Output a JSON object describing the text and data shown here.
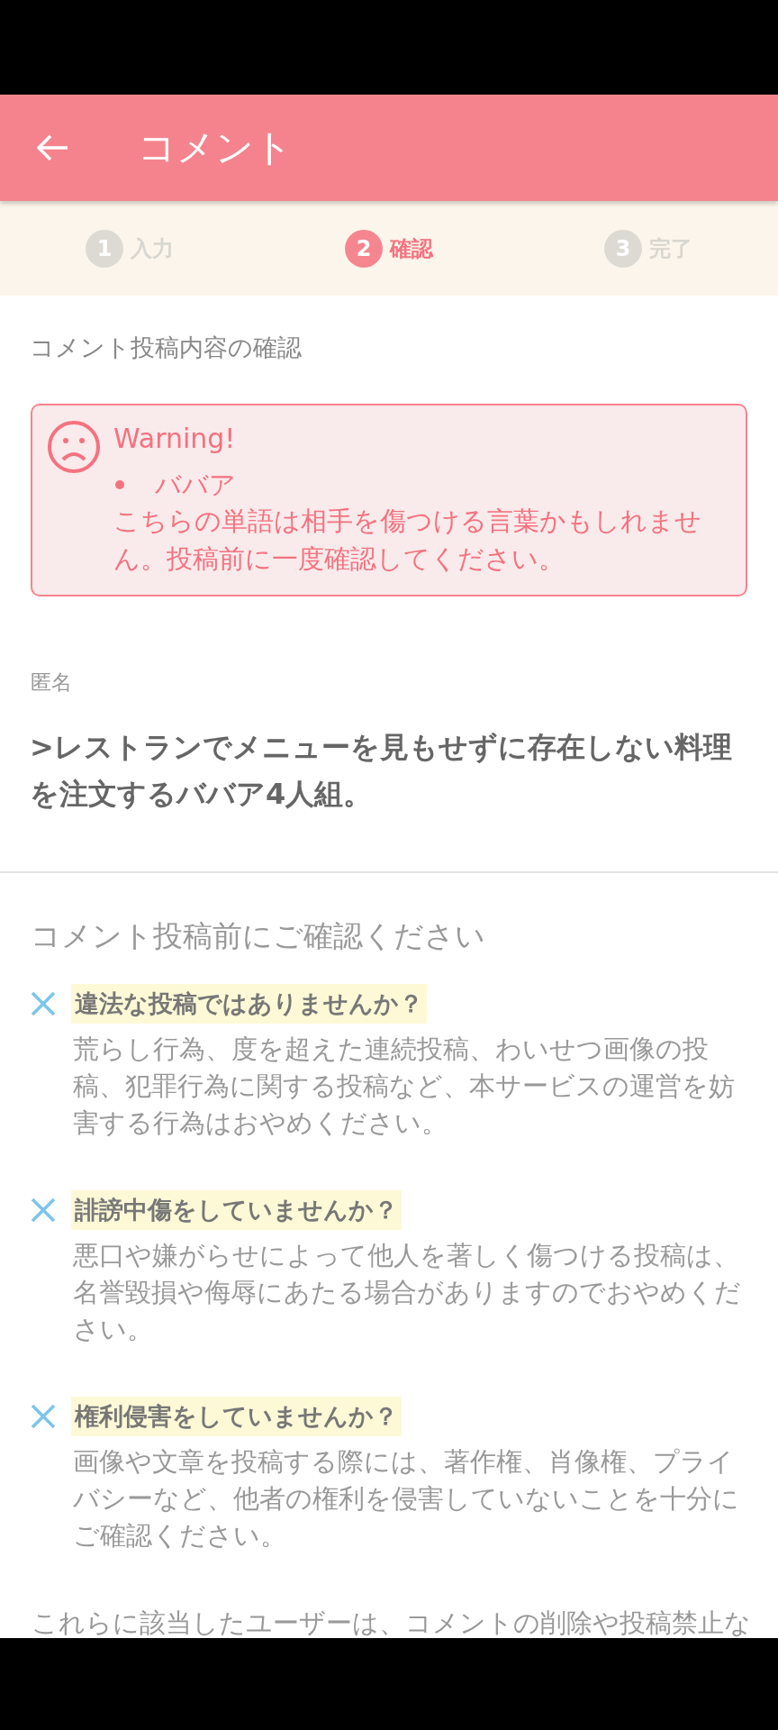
{
  "header": {
    "title": "コメント"
  },
  "steps": [
    {
      "number": "1",
      "label": "入力",
      "selected": false
    },
    {
      "number": "2",
      "label": "確認",
      "selected": true
    },
    {
      "number": "3",
      "label": "完了",
      "selected": false
    }
  ],
  "section_title": "コメント投稿内容の確認",
  "warning": {
    "title": "Warning!",
    "words": [
      "ババア"
    ],
    "message": "こちらの単語は相手を傷つける言葉かもしれません。投稿前に一度確認してください。"
  },
  "comment": {
    "author": "匿名",
    "text": ">レストランでメニューを見もせずに存在しない料理を注文するババア4人組。"
  },
  "guidelines": {
    "title": "コメント投稿前にご確認ください",
    "items": [
      {
        "title": "違法な投稿ではありませんか？",
        "text": "荒らし行為、度を超えた連続投稿、わいせつ画像の投稿、犯罪行為に関する投稿など、本サービスの運営を妨害する行為はおやめください。"
      },
      {
        "title": "誹謗中傷をしていませんか？",
        "text": "悪口や嫌がらせによって他人を著しく傷つける投稿は、名誉毀損や侮辱にあたる場合がありますのでおやめください。"
      },
      {
        "title": "権利侵害をしていませんか？",
        "text": "画像や文章を投稿する際には、著作権、肖像権、プライバシーなど、他者の権利を侵害していないことを十分にご確認ください。"
      }
    ],
    "footer": "これらに該当したユーザーは、コメントの削除や投稿禁止な"
  }
}
